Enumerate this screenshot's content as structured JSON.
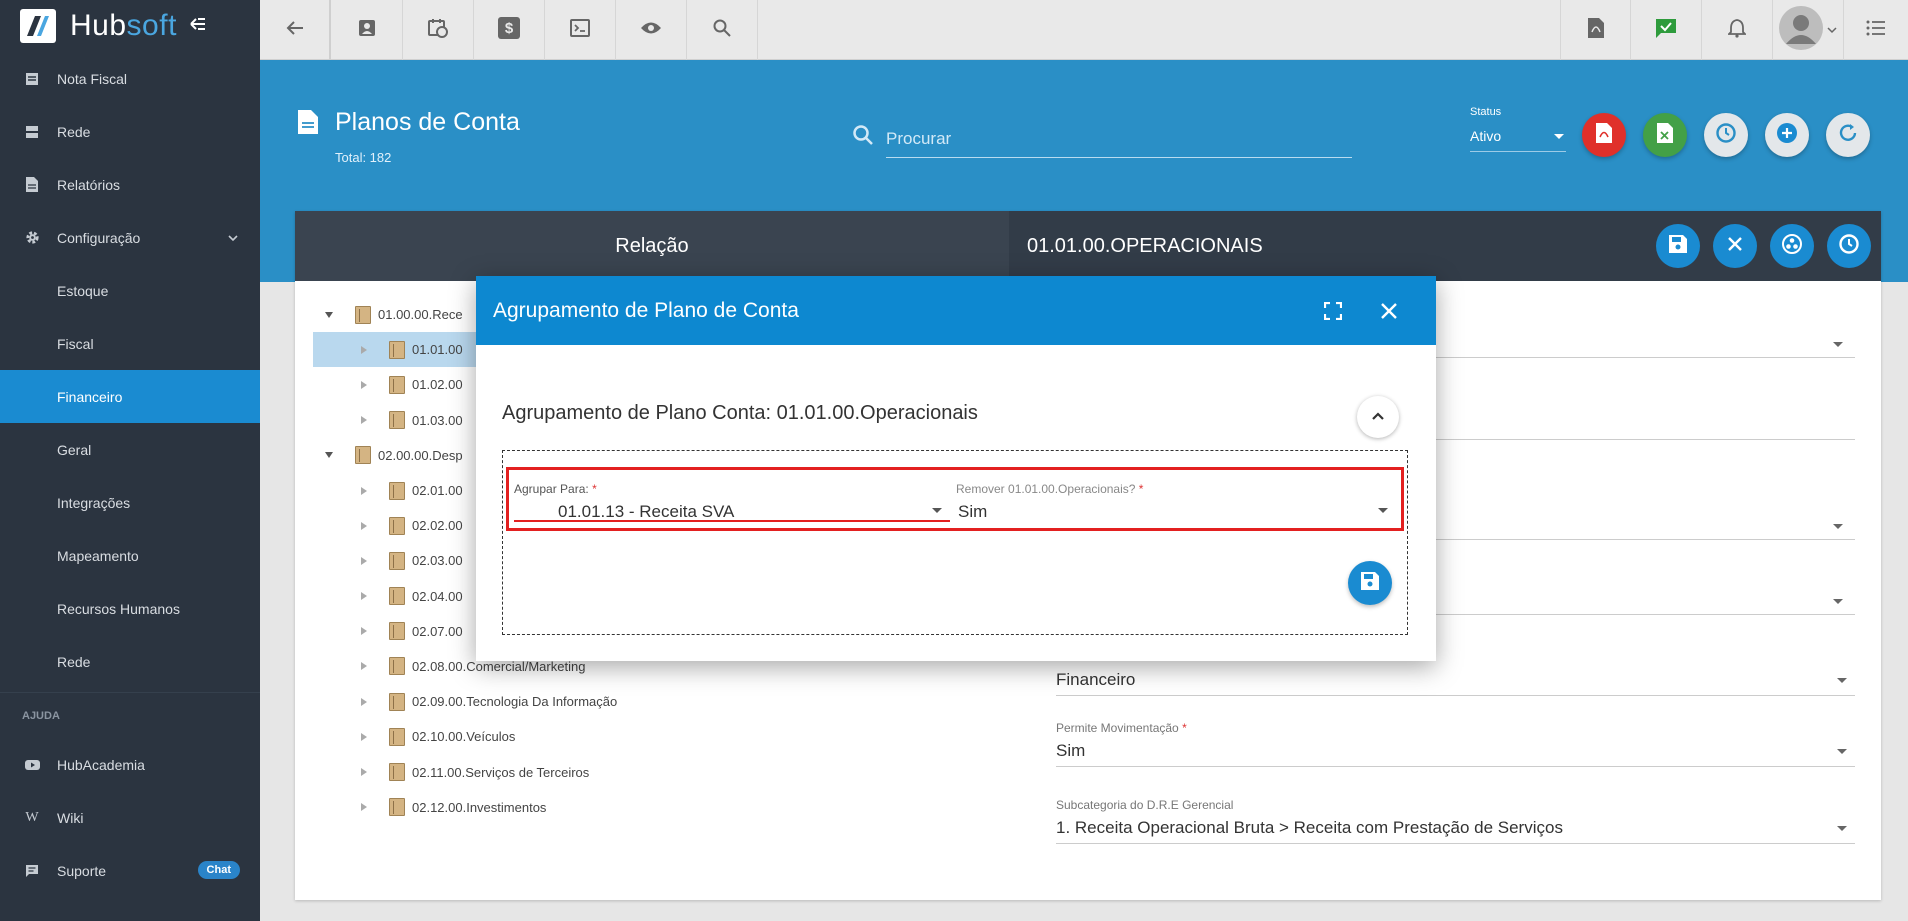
{
  "app": {
    "logo_main": "Hub",
    "logo_accent": "soft"
  },
  "sidebar": {
    "items": [
      {
        "label": "Nota Fiscal",
        "icon": "receipt-icon"
      },
      {
        "label": "Rede",
        "icon": "server-icon"
      },
      {
        "label": "Relatórios",
        "icon": "document-icon"
      },
      {
        "label": "Configuração",
        "icon": "gear-icon"
      },
      {
        "label": "Estoque"
      },
      {
        "label": "Fiscal"
      },
      {
        "label": "Financeiro"
      },
      {
        "label": "Geral"
      },
      {
        "label": "Integrações"
      },
      {
        "label": "Mapeamento"
      },
      {
        "label": "Recursos Humanos"
      },
      {
        "label": "Rede"
      }
    ],
    "section_help": "AJUDA",
    "help_items": [
      {
        "label": "HubAcademia",
        "icon": "youtube-icon"
      },
      {
        "label": "Wiki",
        "icon": "wikipedia-icon"
      },
      {
        "label": "Suporte",
        "icon": "chat-bubble-icon",
        "badge": "Chat"
      }
    ]
  },
  "page": {
    "title": "Planos de Conta",
    "total": "Total: 182",
    "search_placeholder": "Procurar",
    "status_label": "Status",
    "status_value": "Ativo"
  },
  "card": {
    "left_header": "Relação",
    "right_header": "01.01.00.OPERACIONAIS"
  },
  "tree": [
    {
      "label": "01.00.00.Rece",
      "level": 0,
      "expanded": true
    },
    {
      "label": "01.01.00",
      "level": 1,
      "selected": true
    },
    {
      "label": "01.02.00",
      "level": 1
    },
    {
      "label": "01.03.00",
      "level": 1
    },
    {
      "label": "02.00.00.Desp",
      "level": 0,
      "expanded": true
    },
    {
      "label": "02.01.00",
      "level": 1
    },
    {
      "label": "02.02.00",
      "level": 1
    },
    {
      "label": "02.03.00",
      "level": 1
    },
    {
      "label": "02.04.00",
      "level": 1
    },
    {
      "label": "02.07.00",
      "level": 1
    },
    {
      "label": "02.08.00.Comercial/Marketing",
      "level": 1
    },
    {
      "label": "02.09.00.Tecnologia Da Informação",
      "level": 1
    },
    {
      "label": "02.10.00.Veículos",
      "level": 1
    },
    {
      "label": "02.11.00.Serviços de Terceiros",
      "level": 1
    },
    {
      "label": "02.12.00.Investimentos",
      "level": 1
    }
  ],
  "form": {
    "financeiro_value": "Financeiro",
    "permite_label": "Permite Movimentação",
    "permite_value": "Sim",
    "subcat_label": "Subcategoria do D.R.E Gerencial",
    "subcat_value": "1. Receita Operacional Bruta > Receita com Prestação de Serviços"
  },
  "modal": {
    "title": "Agrupamento de Plano de Conta",
    "subtitle": "Agrupamento de Plano Conta: 01.01.00.Operacionais",
    "agrupar_label": "Agrupar Para:",
    "agrupar_value": "01.01.13 - Receita SVA",
    "remover_label": "Remover 01.01.00.Operacionais?",
    "remover_value": "Sim",
    "required_mark": "*"
  },
  "colors": {
    "sidebar_bg": "#2b3440",
    "accent": "#1a8bd1",
    "header_band": "#2a8fc6",
    "pdf_red": "#e0302a",
    "excel_green": "#43a047",
    "highlight_red": "#e32020"
  }
}
